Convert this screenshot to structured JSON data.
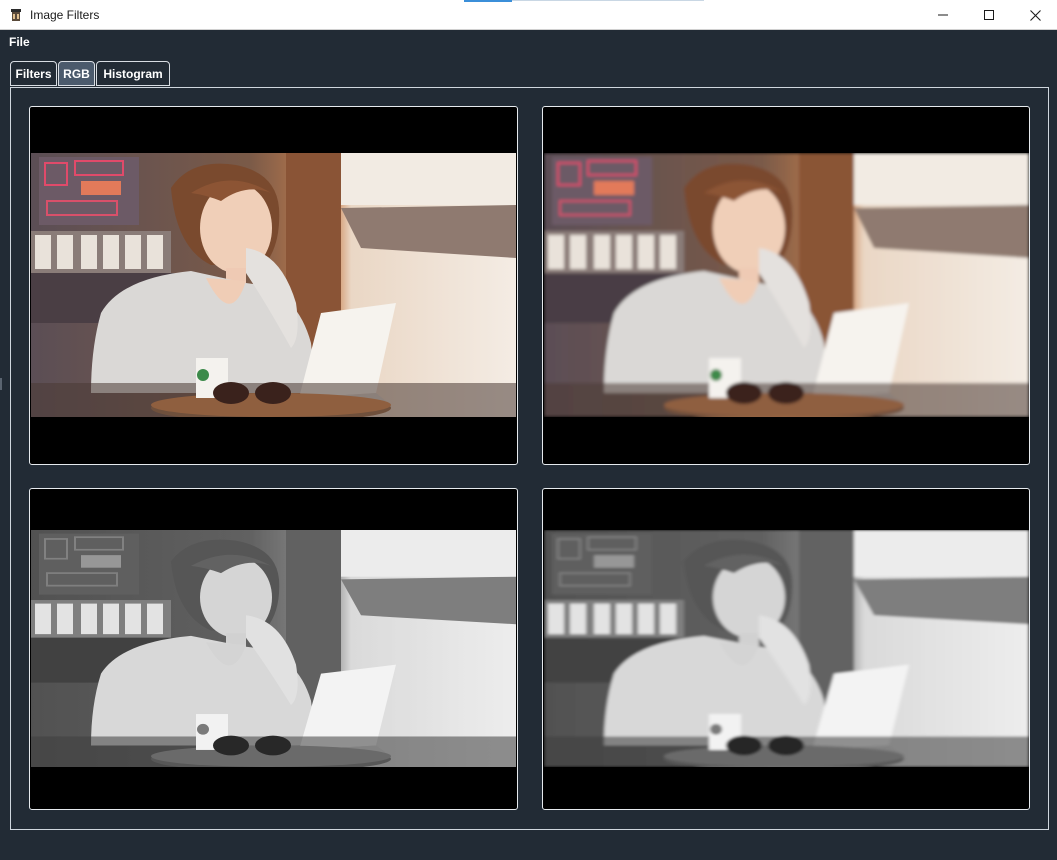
{
  "window": {
    "title": "Image Filters",
    "app_icon": "app-icon",
    "controls": {
      "minimize_icon": "minimize-icon",
      "maximize_icon": "maximize-icon",
      "close_icon": "close-icon"
    }
  },
  "menu": {
    "file_label": "File"
  },
  "tabs": [
    {
      "label": "Filters",
      "active": false
    },
    {
      "label": "RGB",
      "active": true
    },
    {
      "label": "Histogram",
      "active": false
    }
  ],
  "images": [
    {
      "variant": "original-color"
    },
    {
      "variant": "smoothed-color"
    },
    {
      "variant": "grayscale"
    },
    {
      "variant": "smoothed-grayscale"
    }
  ],
  "colors": {
    "background": "#222b35",
    "active_tab": "#4b5a6c",
    "border": "#cfd6dd",
    "title_bar": "#ffffff"
  }
}
